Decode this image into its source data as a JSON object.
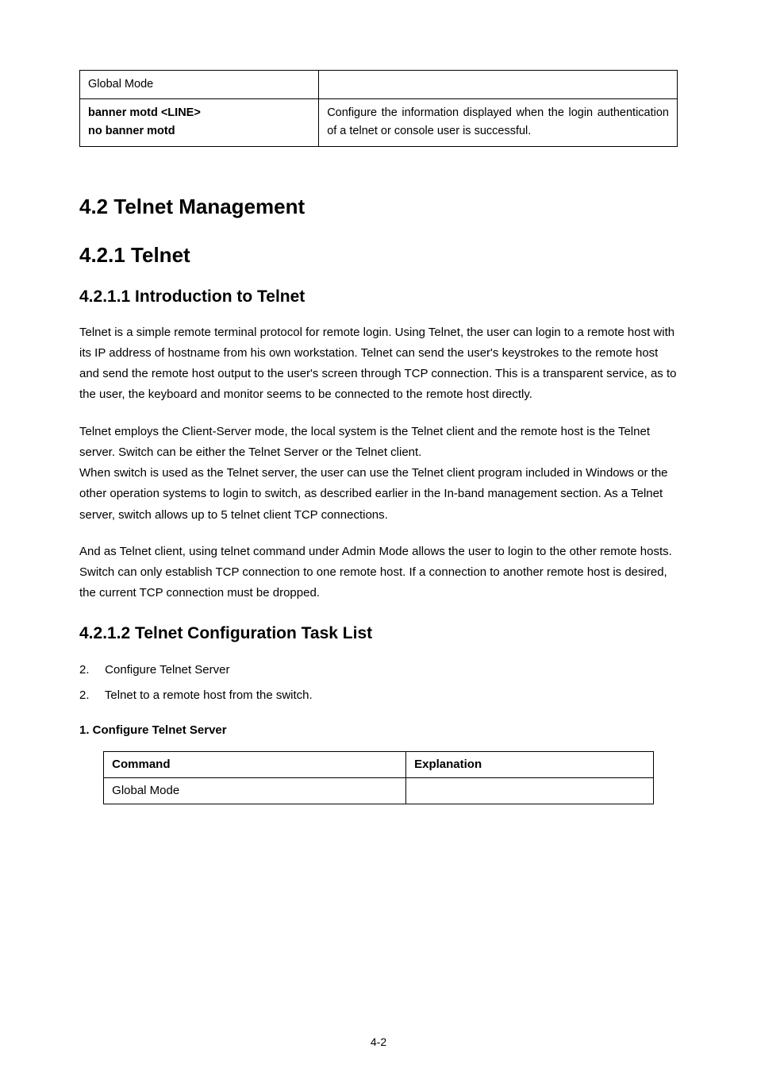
{
  "table1": {
    "row1_left": "Global Mode",
    "row2_left_line1": "banner motd <LINE>",
    "row2_left_line2": "no banner motd",
    "row2_right": "Configure the information displayed when the login authentication of a telnet or console user is successful."
  },
  "h_4_2": "4.2 Telnet Management",
  "h_4_2_1": "4.2.1 Telnet",
  "h_4_2_1_1": "4.2.1.1 Introduction to Telnet",
  "para1": "Telnet is a simple remote terminal protocol for remote login. Using Telnet, the user can login to a remote host with its IP address of hostname from his own workstation. Telnet can send the user's keystrokes to the remote host and send the remote host output to the user's screen through TCP connection. This is a transparent service, as to the user, the keyboard and monitor seems to be connected to the remote host directly.",
  "para2": "Telnet employs the Client-Server mode, the local system is the Telnet client and the remote host is the Telnet server. Switch can be either the Telnet Server or the Telnet client.\nWhen switch is used as the Telnet server, the user can use the Telnet client program included in Windows or the other operation systems to login to switch, as described earlier in the In-band management section. As a Telnet server, switch allows up to 5 telnet client TCP connections.",
  "para3": "And as Telnet client, using telnet command under Admin Mode allows the user to login to the other remote hosts. Switch can only establish TCP connection to one remote host. If a connection to another remote host is desired, the current TCP connection must be dropped.",
  "h_4_2_1_2": "4.2.1.2 Telnet Configuration Task List",
  "list": {
    "item1_num": "2.",
    "item1_text": "Configure Telnet Server",
    "item2_num": "2.",
    "item2_text": "Telnet to a remote host from the switch."
  },
  "subhead": "1. Configure Telnet Server",
  "table2": {
    "h_left": "Command",
    "h_right": "Explanation",
    "r1_left": "Global Mode"
  },
  "pagenum": "4-2"
}
